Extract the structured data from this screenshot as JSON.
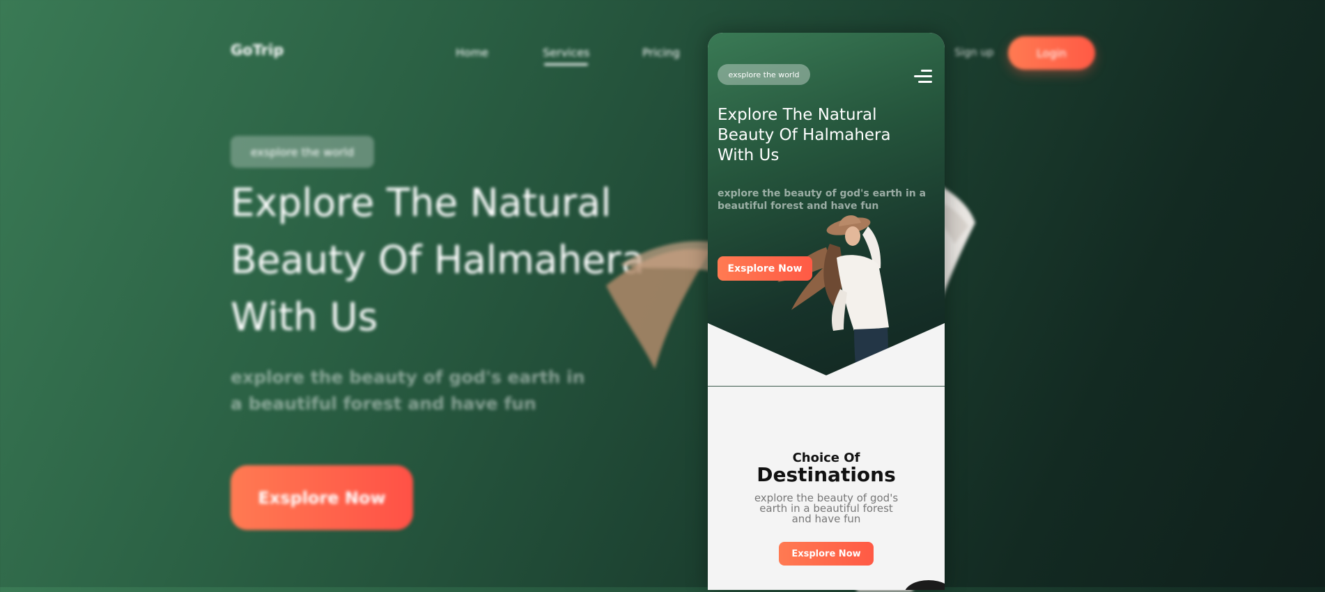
{
  "desktop": {
    "logo": "GoTrip",
    "nav": {
      "home": "Home",
      "services": "Services",
      "pricing": "Pricing"
    },
    "signup": "Sign up",
    "login": "Login",
    "badge": "exsplore the world",
    "title": "Explore The Natural Beauty Of Halmahera With Us",
    "subtitle": "explore the beauty of god's earth in a beautiful forest and have fun",
    "cta": "Exsplore Now"
  },
  "mobile": {
    "badge": "exsplore the world",
    "title": "Explore The Natural Beauty Of Halmahera With Us",
    "subtitle": "explore the beauty of god's earth in a beautiful forest and have fun",
    "cta": "Exsplore Now",
    "section_heading_small": "Choice Of",
    "section_heading_big": "Destinations",
    "section_text": "explore the beauty of god's earth in a beautiful forest and have fun",
    "section_cta": "Exsplore Now"
  },
  "colors": {
    "accent": "#ff6a4d",
    "green_light": "#3a7a55",
    "green_dark": "#112520",
    "section_bg": "#f4f4f4"
  },
  "icons": {
    "menu": "hamburger-menu-icon"
  }
}
